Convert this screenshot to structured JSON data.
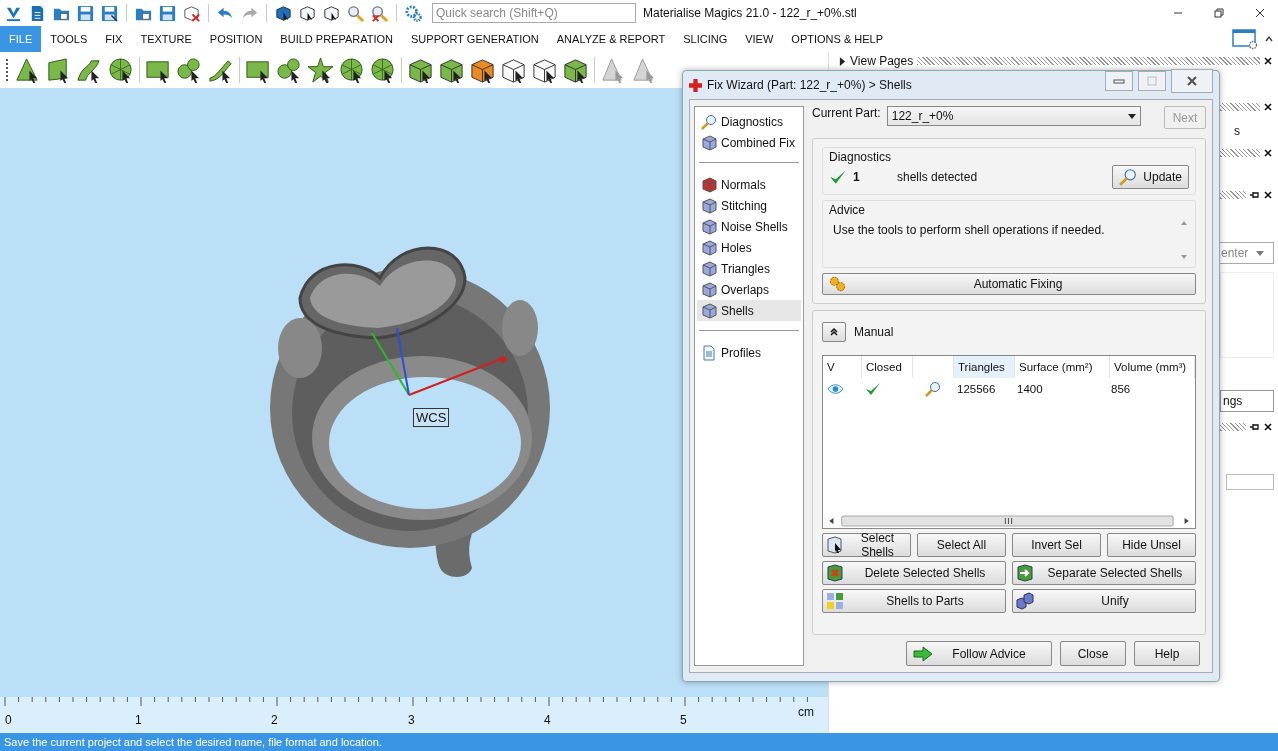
{
  "window": {
    "title": "Materialise Magics 21.0 - 122_r_+0%.stl"
  },
  "quick_search": {
    "placeholder": "Quick search (Shift+Q)"
  },
  "menu": [
    {
      "label": "FILE",
      "selected": true
    },
    {
      "label": "TOOLS",
      "selected": false
    },
    {
      "label": "FIX",
      "selected": false
    },
    {
      "label": "TEXTURE",
      "selected": false
    },
    {
      "label": "POSITION",
      "selected": false
    },
    {
      "label": "BUILD PREPARATION",
      "selected": false
    },
    {
      "label": "SUPPORT GENERATION",
      "selected": false
    },
    {
      "label": "ANALYZE & REPORT",
      "selected": false
    },
    {
      "label": "SLICING",
      "selected": false
    },
    {
      "label": "VIEW",
      "selected": false
    },
    {
      "label": "OPTIONS & HELP",
      "selected": false
    }
  ],
  "viewport": {
    "axis_label": "WCS"
  },
  "ruler": {
    "ticks": [
      "0",
      "1",
      "2",
      "3",
      "4",
      "5"
    ],
    "unit": "cm"
  },
  "side_panel": {
    "header": "View Pages",
    "fragment_1": "s",
    "dropdown_fragment": "enter",
    "field_fragment": "ngs"
  },
  "fix_wizard": {
    "title": "Fix Wizard (Part: 122_r_+0%) > Shells",
    "nav_groups": [
      [
        {
          "label": "Diagnostics",
          "selected": false
        },
        {
          "label": "Combined Fix",
          "selected": false
        }
      ],
      [
        {
          "label": "Normals",
          "selected": false
        },
        {
          "label": "Stitching",
          "selected": false
        },
        {
          "label": "Noise Shells",
          "selected": false
        },
        {
          "label": "Holes",
          "selected": false
        },
        {
          "label": "Triangles",
          "selected": false
        },
        {
          "label": "Overlaps",
          "selected": false
        },
        {
          "label": "Shells",
          "selected": true
        }
      ],
      [
        {
          "label": "Profiles",
          "selected": false
        }
      ]
    ],
    "current_part_label": "Current Part:",
    "current_part": "122_r_+0%",
    "next": {
      "label": "Next",
      "disabled": true
    },
    "diagnostics": {
      "title": "Diagnostics",
      "ok": true,
      "count": "1",
      "text": "shells detected",
      "update": "Update"
    },
    "advice": {
      "title": "Advice",
      "text": "Use the tools to perform shell operations if needed."
    },
    "automatic_fixing": "Automatic Fixing",
    "manual": {
      "title": "Manual",
      "expanded": true
    },
    "table": {
      "columns": [
        "V",
        "Closed",
        "Triangles",
        "Surface (mm²)",
        "Volume (mm³)"
      ],
      "rows": [
        {
          "visible": true,
          "closed": true,
          "triangles": "125566",
          "surface": "1400",
          "volume": "856"
        }
      ]
    },
    "button_rows": [
      [
        {
          "label": "Select Shells",
          "kind": "select"
        },
        {
          "label": "Select All",
          "kind": "plain"
        },
        {
          "label": "Invert Sel",
          "kind": "plain"
        },
        {
          "label": "Hide Unsel",
          "kind": "plain"
        }
      ],
      [
        {
          "label": "Delete Selected Shells",
          "kind": "delete"
        },
        {
          "label": "Separate Selected Shells",
          "kind": "separate"
        }
      ],
      [
        {
          "label": "Shells to Parts",
          "kind": "parts"
        },
        {
          "label": "Unify",
          "kind": "unify"
        }
      ]
    ],
    "footer": [
      "Follow Advice",
      "Close",
      "Help"
    ]
  },
  "status_bar": "Save the current project and select the desired name, file format and location."
}
